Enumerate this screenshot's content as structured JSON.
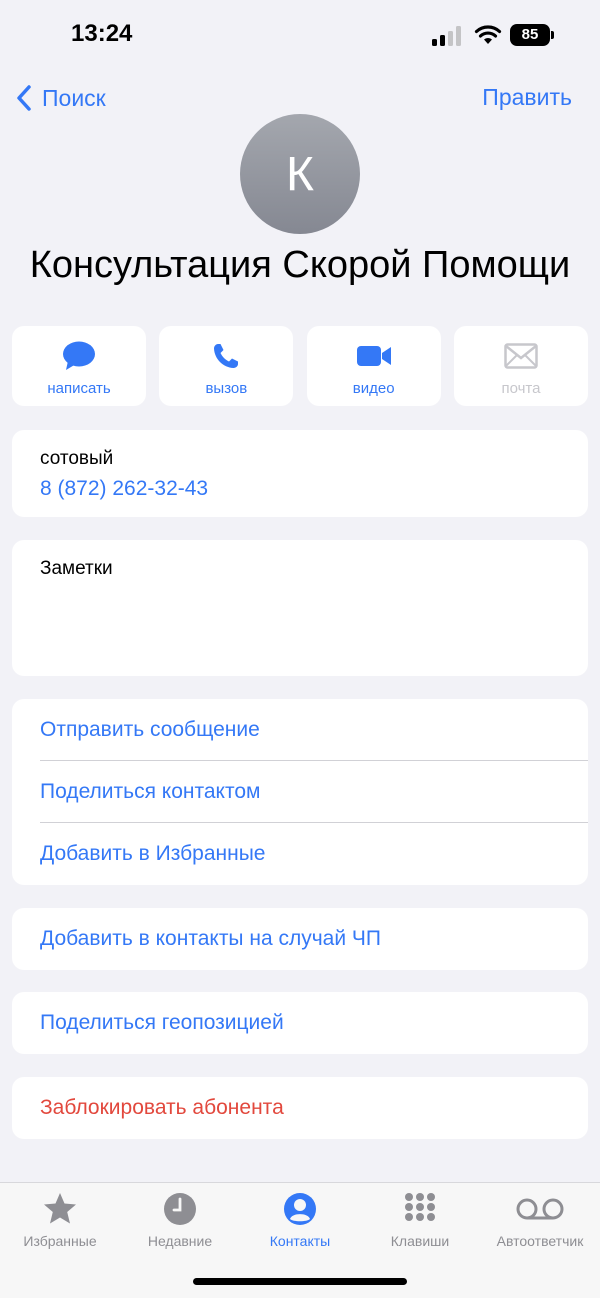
{
  "status": {
    "time": "13:24",
    "battery": "85"
  },
  "nav": {
    "back_label": "Поиск",
    "edit_label": "Править"
  },
  "contact": {
    "initial": "К",
    "name": "Консультация Скорой Помощи"
  },
  "actions": [
    {
      "label": "написать",
      "icon": "message-bubble-icon",
      "enabled": true
    },
    {
      "label": "вызов",
      "icon": "phone-icon",
      "enabled": true
    },
    {
      "label": "видео",
      "icon": "video-camera-icon",
      "enabled": true
    },
    {
      "label": "почта",
      "icon": "mail-envelope-icon",
      "enabled": false
    }
  ],
  "phone": {
    "label": "сотовый",
    "number": "8 (872) 262-32-43"
  },
  "notes": {
    "label": "Заметки"
  },
  "options": [
    "Отправить сообщение",
    "Поделиться контактом",
    "Добавить в Избранные"
  ],
  "emergency": "Добавить в контакты на случай ЧП",
  "share_location": "Поделиться геопозицией",
  "block": "Заблокировать абонента",
  "tabs": [
    {
      "label": "Избранные",
      "icon": "star-icon",
      "active": false
    },
    {
      "label": "Недавние",
      "icon": "clock-icon",
      "active": false
    },
    {
      "label": "Контакты",
      "icon": "person-circle-icon",
      "active": true
    },
    {
      "label": "Клавиши",
      "icon": "keypad-icon",
      "active": false
    },
    {
      "label": "Автоответчик",
      "icon": "voicemail-icon",
      "active": false
    }
  ],
  "colors": {
    "accent": "#3478f6",
    "destructive": "#e2483d",
    "background": "#f2f2f7",
    "inactive": "#8e8e93"
  }
}
